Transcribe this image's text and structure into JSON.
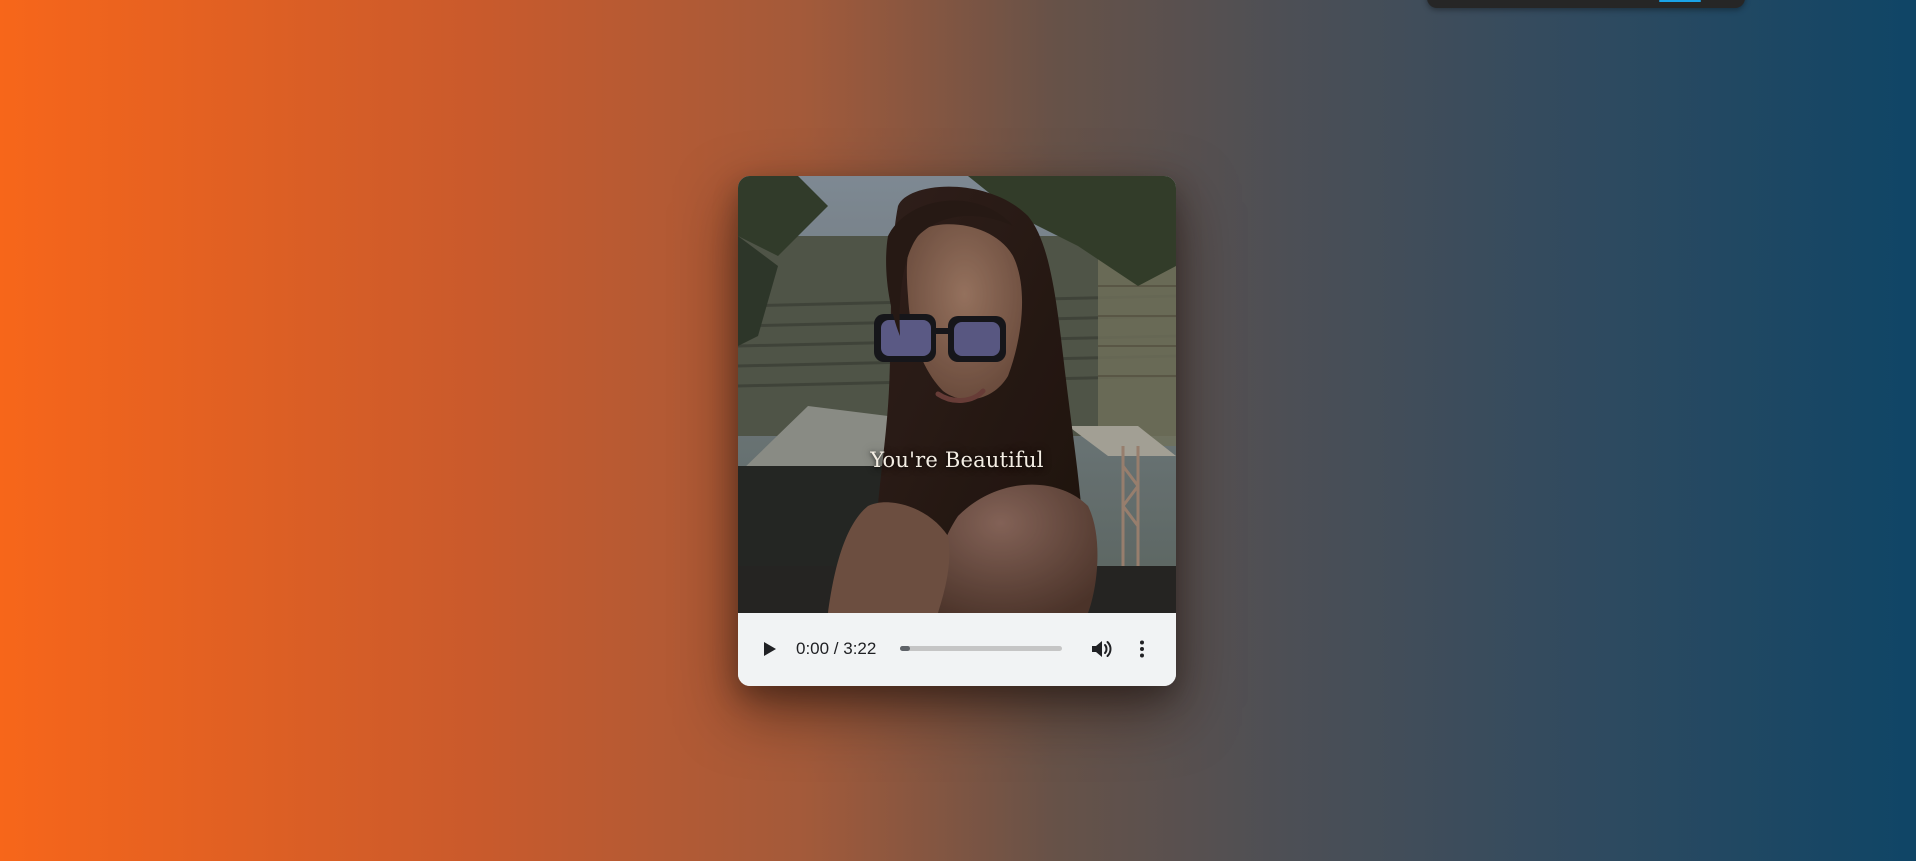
{
  "page": {
    "background_colors": [
      "#f7661a",
      "#a35a3a",
      "#4d4f55",
      "#0f4566"
    ]
  },
  "top_widget": {
    "background_color": "#262626",
    "accent_color": "#1aa3e8"
  },
  "media_card": {
    "video": {
      "caption": "You're Beautiful"
    },
    "controls": {
      "play_icon": "play-icon",
      "current_time": "0:00",
      "duration": "3:22",
      "time_display": "0:00 / 3:22",
      "progress_fraction": 0.06,
      "volume_icon": "volume-icon",
      "menu_icon": "more-vertical-icon",
      "background_color": "#f1f3f4"
    }
  }
}
